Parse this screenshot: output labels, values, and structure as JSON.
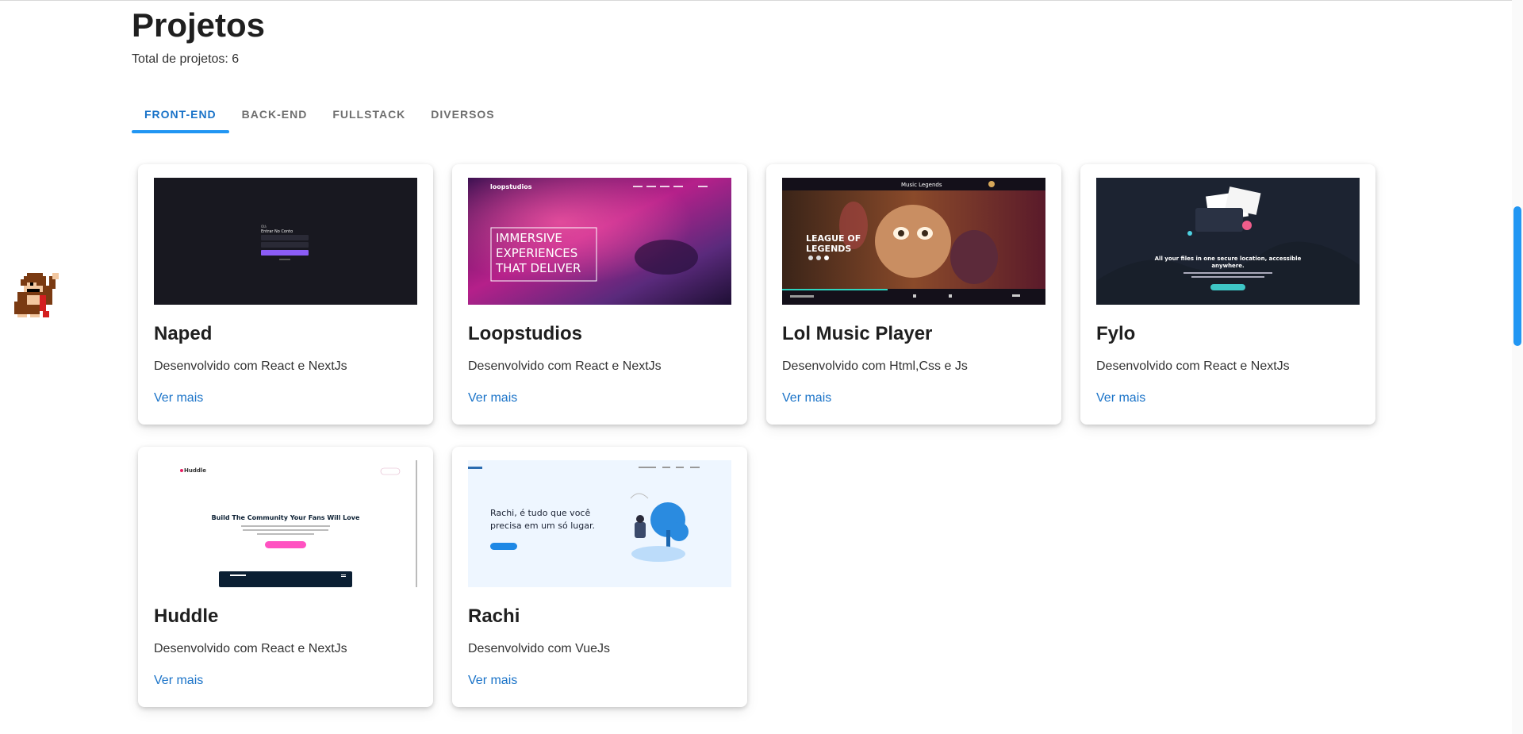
{
  "page": {
    "title": "Projetos",
    "subtitle": "Total de projetos: 6"
  },
  "tabs": [
    {
      "label": "FRONT-END",
      "active": true
    },
    {
      "label": "BACK-END",
      "active": false
    },
    {
      "label": "FULLSTACK",
      "active": false
    },
    {
      "label": "DIVERSOS",
      "active": false
    }
  ],
  "projects": [
    {
      "title": "Naped",
      "description": "Desenvolvido com React e NextJs",
      "link": "Ver mais",
      "thumb_text": [
        "Entrar No Conto"
      ]
    },
    {
      "title": "Loopstudios",
      "description": "Desenvolvido com React e NextJs",
      "link": "Ver mais",
      "thumb_text": [
        "loopstudios",
        "IMMERSIVE",
        "EXPERIENCES",
        "THAT DELIVER"
      ]
    },
    {
      "title": "Lol Music Player",
      "description": "Desenvolvido com Html,Css e Js",
      "link": "Ver mais",
      "thumb_text": [
        "Music Legends",
        "LEAGUE OF",
        "LEGENDS"
      ]
    },
    {
      "title": "Fylo",
      "description": "Desenvolvido com React e NextJs",
      "link": "Ver mais",
      "thumb_text": [
        "All your files in one secure location, accessible",
        "anywhere."
      ]
    },
    {
      "title": "Huddle",
      "description": "Desenvolvido com React e NextJs",
      "link": "Ver mais",
      "thumb_text": [
        "Huddle",
        "Build The Community Your Fans Will Love"
      ]
    },
    {
      "title": "Rachi",
      "description": "Desenvolvido com VueJs",
      "link": "Ver mais",
      "thumb_text": [
        "Rachi, é tudo que você",
        "precisa em um só lugar."
      ]
    }
  ],
  "colors": {
    "accent": "#2196f3",
    "link": "#1a73c8"
  }
}
